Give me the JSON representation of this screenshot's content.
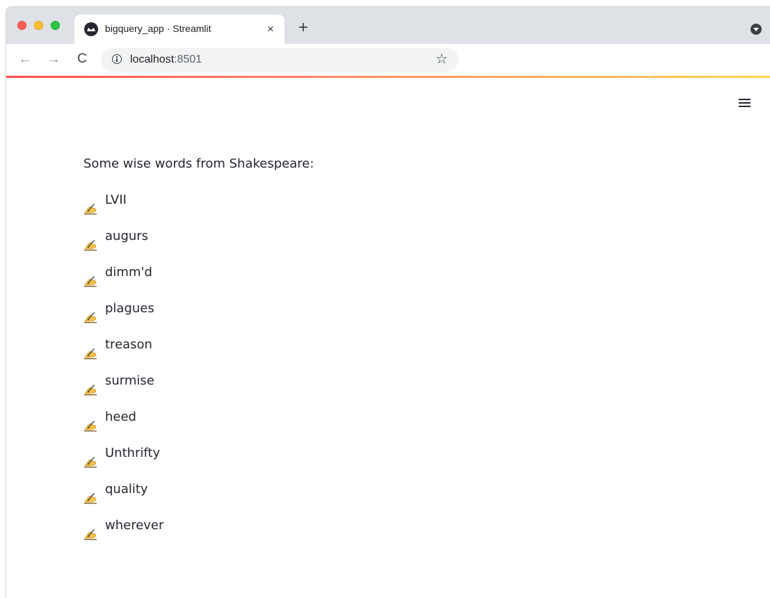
{
  "browser": {
    "tab_title": "bigquery_app · Streamlit",
    "tab_close_glyph": "×",
    "new_tab_glyph": "+",
    "url_host": "localhost",
    "url_port": ":8501",
    "back_glyph": "←",
    "forward_glyph": "→",
    "reload_glyph": "C",
    "star_glyph": "☆"
  },
  "page": {
    "intro": "Some wise words from Shakespeare:",
    "bullet_icon": "writing-hand-icon",
    "words": [
      "LVII",
      "augurs",
      "dimm'd",
      "plagues",
      "treason",
      "surmise",
      "heed",
      "Unthrifty",
      "quality",
      "wherever"
    ]
  },
  "colors": {
    "text": "#262730",
    "accent_start": "#ff4b4b",
    "accent_end": "#ffd54f",
    "pen_yellow": "#f5c242"
  }
}
